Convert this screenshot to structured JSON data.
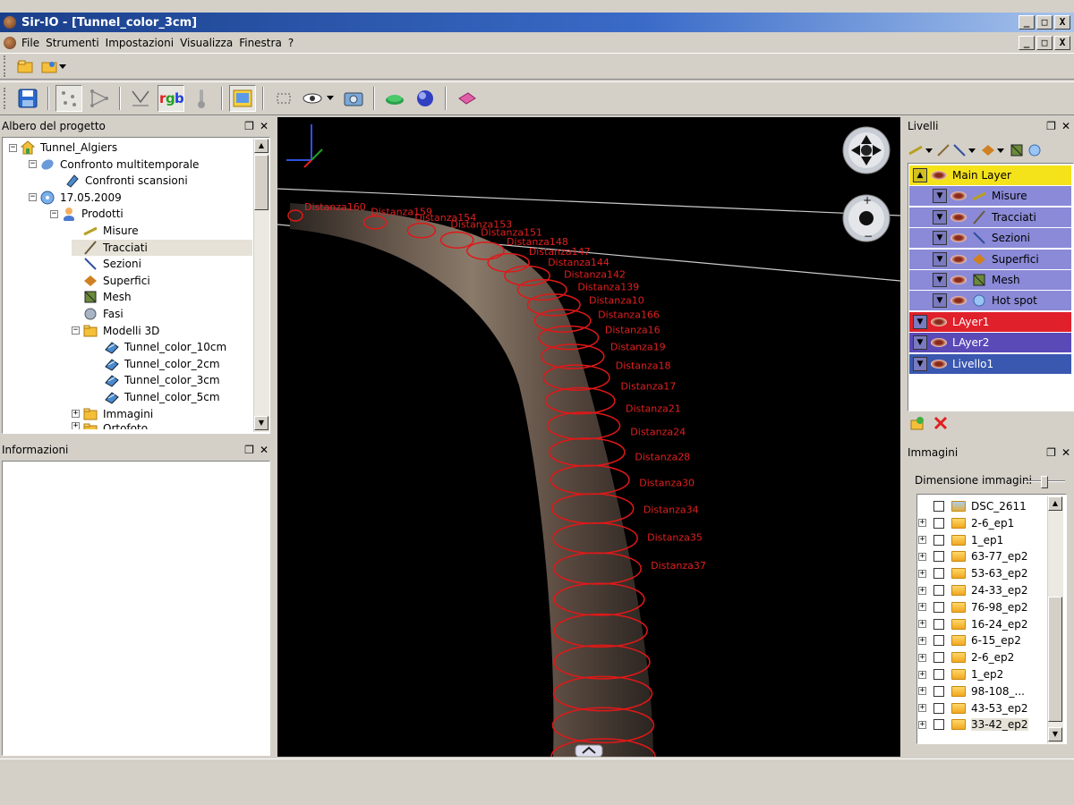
{
  "window": {
    "title": "Sir-IO - [Tunnel_color_3cm]",
    "buttons": [
      "_",
      "□",
      "X"
    ]
  },
  "menu": {
    "items": [
      "File",
      "Strumenti",
      "Impostazioni",
      "Visualizza",
      "Finestra",
      "?"
    ]
  },
  "project_panel": {
    "title": "Albero del progetto",
    "tree": [
      {
        "label": "Tunnel_Algiers"
      },
      {
        "label": "Confronto multitemporale"
      },
      {
        "label": "Confronti scansioni"
      },
      {
        "label": "17.05.2009"
      },
      {
        "label": "Prodotti"
      },
      {
        "label": "Misure"
      },
      {
        "label": "Tracciati"
      },
      {
        "label": "Sezioni"
      },
      {
        "label": "Superfici"
      },
      {
        "label": "Mesh"
      },
      {
        "label": "Fasi"
      },
      {
        "label": "Modelli 3D"
      },
      {
        "label": "Tunnel_color_10cm"
      },
      {
        "label": "Tunnel_color_2cm"
      },
      {
        "label": "Tunnel_color_3cm"
      },
      {
        "label": "Tunnel_color_5cm"
      },
      {
        "label": "Immagini"
      },
      {
        "label": "Ortofoto"
      }
    ]
  },
  "info_panel": {
    "title": "Informazioni"
  },
  "viewport": {
    "labels": [
      "Distanza160",
      "Distanza159",
      "Distanza154",
      "Distanza153",
      "Distanza151",
      "Distanza148",
      "Distanza147",
      "Distanza144",
      "Distanza142",
      "Distanza139",
      "Distanza10",
      "Distanza166",
      "Distanza16",
      "Distanza19",
      "Distanza18",
      "Distanza17",
      "Distanza21",
      "Distanza24",
      "Distanza28",
      "Distanza30",
      "Distanza34",
      "Distanza35",
      "Distanza37"
    ]
  },
  "layers_panel": {
    "title": "Livelli",
    "layers": [
      {
        "label": "Main Layer",
        "bg": "#f4e21a"
      },
      {
        "label": "Misure",
        "bg": "#8a8ad8"
      },
      {
        "label": "Tracciati",
        "bg": "#8a8ad8"
      },
      {
        "label": "Sezioni",
        "bg": "#8a8ad8"
      },
      {
        "label": "Superfici",
        "bg": "#8a8ad8"
      },
      {
        "label": "Mesh",
        "bg": "#8a8ad8"
      },
      {
        "label": "Hot spot",
        "bg": "#8a8ad8"
      },
      {
        "label": "LAyer1",
        "bg": "#e0202a"
      },
      {
        "label": "LAyer2",
        "bg": "#5a4ab8"
      },
      {
        "label": "Livello1",
        "bg": "#3a58b0"
      }
    ]
  },
  "images_panel": {
    "title": "Immagini",
    "size_label": "Dimensione immagini",
    "size_value": 0.5,
    "items": [
      {
        "label": "DSC_2611"
      },
      {
        "label": "2-6_ep1"
      },
      {
        "label": "1_ep1"
      },
      {
        "label": "63-77_ep2"
      },
      {
        "label": "53-63_ep2"
      },
      {
        "label": "24-33_ep2"
      },
      {
        "label": "76-98_ep2"
      },
      {
        "label": "16-24_ep2"
      },
      {
        "label": "6-15_ep2"
      },
      {
        "label": "2-6_ep2"
      },
      {
        "label": "1_ep2"
      },
      {
        "label": "98-108_..."
      },
      {
        "label": "43-53_ep2"
      },
      {
        "label": "33-42_ep2"
      }
    ]
  }
}
